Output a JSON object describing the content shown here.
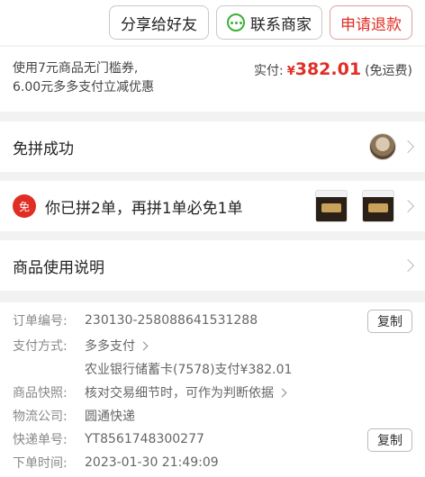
{
  "topbar": {
    "share_label": "分享给好友",
    "contact_label": "联系商家",
    "refund_label": "申请退款"
  },
  "payment": {
    "promo_line1": "使用7元商品无门槛券,",
    "promo_line2": "6.00元多多支付立减优惠",
    "paid_label": "实付:",
    "currency": "¥",
    "amount": "382.01",
    "shipping_note": "(免运费)"
  },
  "group": {
    "title": "免拼成功"
  },
  "promo_row": {
    "badge": "免",
    "text": "你已拼2单，再拼1单必免1单"
  },
  "usage": {
    "title": "商品使用说明"
  },
  "order": {
    "order_no_label": "订单编号:",
    "order_no": "230130-258088641531288",
    "copy_label": "复制",
    "pay_method_label": "支付方式:",
    "pay_method": "多多支付",
    "pay_detail": "农业银行储蓄卡(7578)支付¥382.01",
    "snapshot_label": "商品快照:",
    "snapshot_text": "核对交易细节时，可作为判断依据",
    "logistics_label": "物流公司:",
    "logistics": "圆通快递",
    "tracking_label": "快递单号:",
    "tracking_no": "YT8561748300277",
    "time_label": "下单时间:",
    "time": "2023-01-30 21:49:09"
  },
  "colors": {
    "accent": "#e02e24",
    "wechat_green": "#3cb035"
  }
}
